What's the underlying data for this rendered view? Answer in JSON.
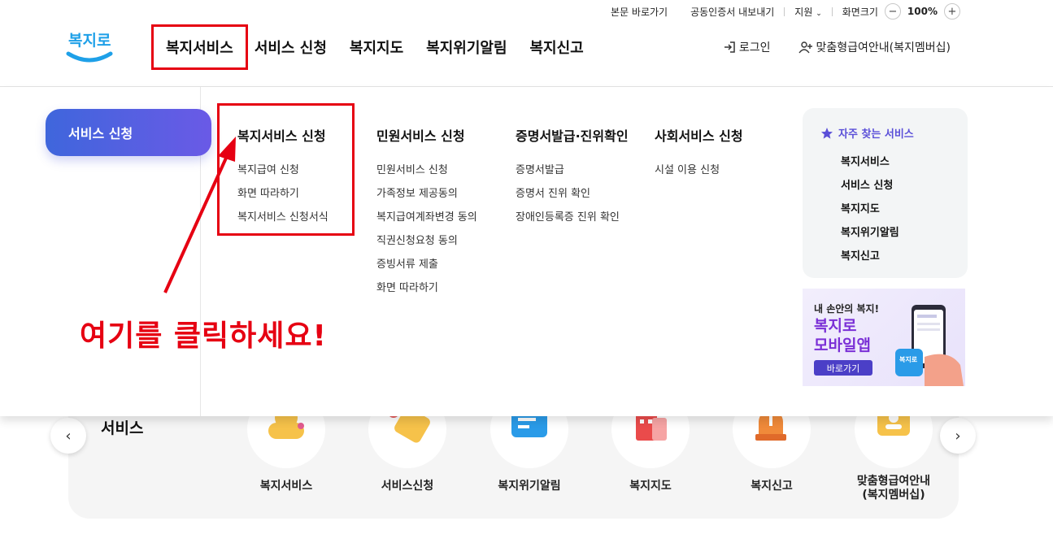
{
  "utility": {
    "skip": "본문 바로가기",
    "cert": "공동인증서 내보내기",
    "support": "지원",
    "screen_size": "화면크기",
    "zoom": "100%",
    "minus": "−",
    "plus": "+"
  },
  "logo": {
    "text": "복지로"
  },
  "gnb": [
    "복지서비스",
    "서비스 신청",
    "복지지도",
    "복지위기알림",
    "복지신고"
  ],
  "header_right": {
    "login": "로그인",
    "membership": "맞춤형급여안내(복지멤버십)"
  },
  "mega": {
    "side_active": "서비스 신청",
    "columns": [
      {
        "title": "복지서비스 신청",
        "links": [
          "복지급여 신청",
          "화면 따라하기",
          "복지서비스 신청서식"
        ]
      },
      {
        "title": "민원서비스 신청",
        "links": [
          "민원서비스 신청",
          "가족정보 제공동의",
          "복지급여계좌변경 동의",
          "직권신청요청 동의",
          "증빙서류 제출",
          "화면 따라하기"
        ]
      },
      {
        "title": "증명서발급·진위확인",
        "links": [
          "증명서발급",
          "증명서 진위 확인",
          "장애인등록증 진위 확인"
        ]
      },
      {
        "title": "사회서비스 신청",
        "links": [
          "시설 이용 신청"
        ]
      }
    ],
    "favorites": {
      "title": "자주 찾는 서비스",
      "items": [
        "복지서비스",
        "서비스 신청",
        "복지지도",
        "복지위기알림",
        "복지신고"
      ]
    },
    "banner": {
      "line1": "내 손안의 복지!",
      "line2": "복지로",
      "line3": "모바일앱",
      "button": "바로가기",
      "app_icon": "복지로"
    }
  },
  "annotation": {
    "callout": "여기를 클릭하세요!"
  },
  "lower": {
    "title": "서비스",
    "prev": "‹",
    "next": "›",
    "items": [
      {
        "label": "복지서비스",
        "icon": "person-icon"
      },
      {
        "label": "서비스신청",
        "icon": "hand-icon"
      },
      {
        "label": "복지위기알림",
        "icon": "notice-icon"
      },
      {
        "label": "복지지도",
        "icon": "building-icon"
      },
      {
        "label": "복지신고",
        "icon": "siren-icon"
      },
      {
        "label": "맞춤형급여안내\n(복지멤버십)",
        "icon": "idcard-icon"
      }
    ]
  },
  "colors": {
    "highlight": "#e60012",
    "brand": "#5a4fd8",
    "logo": "#1ea0e8"
  }
}
